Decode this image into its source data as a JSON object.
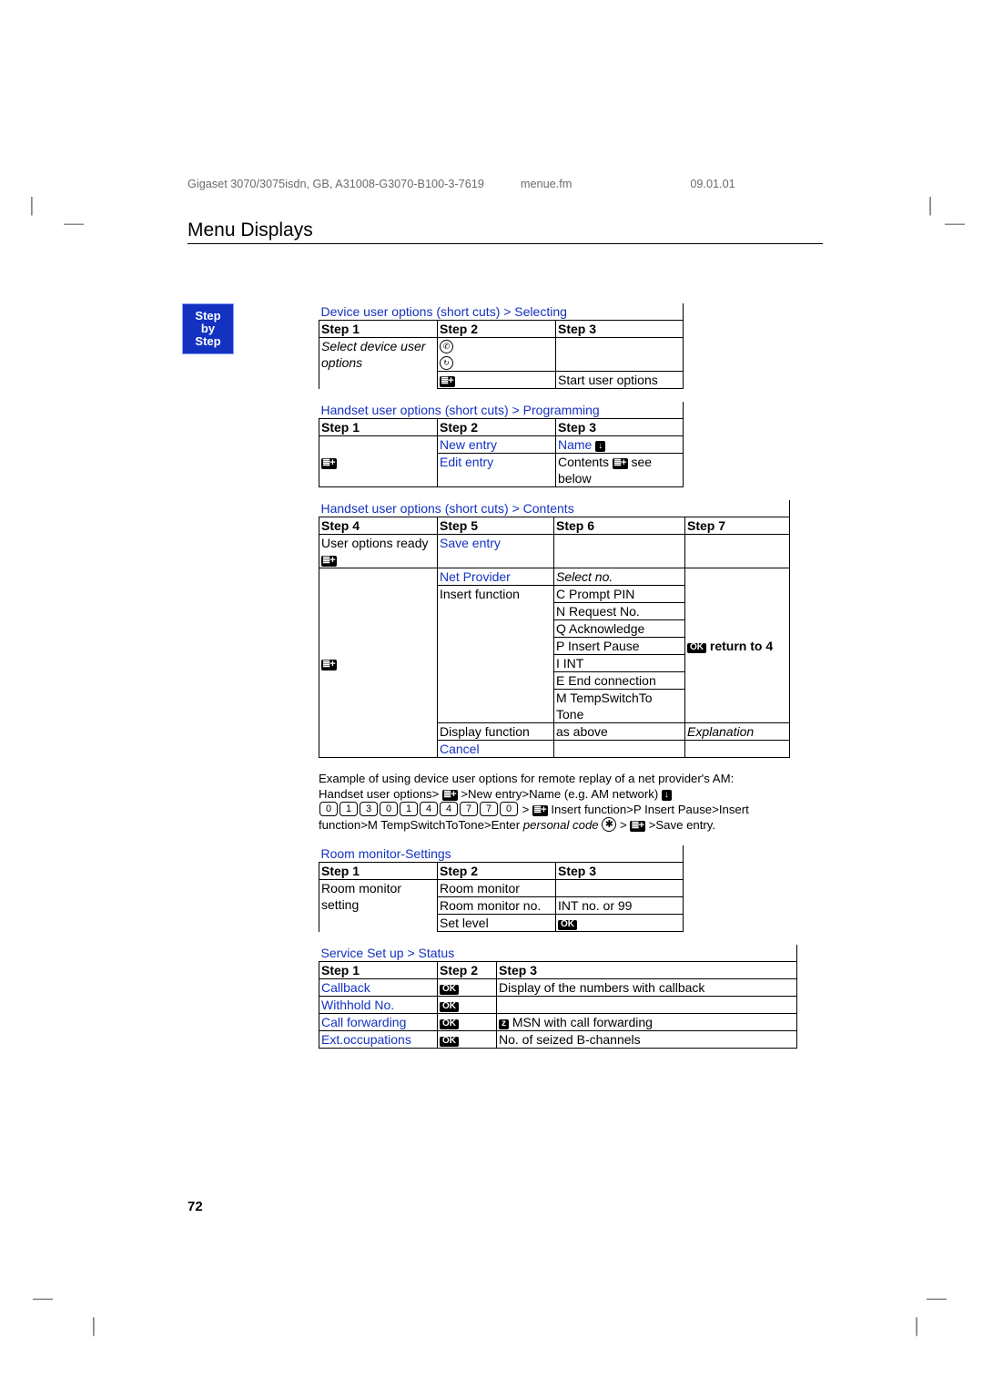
{
  "runhead": {
    "left": "Gigaset 3070/3075isdn, GB, A31008-G3070-B100-3-7619",
    "mid": "menue.fm",
    "right": "09.01.01"
  },
  "section_title": "Menu Displays",
  "steptab": {
    "l1": "Step",
    "l2": "by",
    "l3": "Step"
  },
  "t1": {
    "caption": "Device user options (short cuts) > Selecting",
    "h1": "Step 1",
    "h2": "Step 2",
    "h3": "Step 3",
    "r1c1a": "Select device user",
    "r1c1b": "options",
    "r2c3": "Start user options"
  },
  "t2": {
    "caption": "Handset user options (short cuts) > Programming",
    "h1": "Step 1",
    "h2": "Step 2",
    "h3": "Step 3",
    "r1c2": "New entry",
    "r1c3": "Name",
    "r2c2": "Edit entry",
    "r2c3a": "Contents",
    "r2c3b": " see below"
  },
  "t3": {
    "caption": "Handset user options (short cuts) > Contents",
    "h1": "Step 4",
    "h2": "Step 5",
    "h3": "Step 6",
    "h4": "Step 7",
    "r1c1": "User options ready",
    "r1c2": "Save entry",
    "r2c2": "Net Provider",
    "r2c3": "Select no.",
    "r3c2": "Insert function",
    "r3c3_1": "C Prompt PIN",
    "r3c3_2": "N Request No.",
    "r3c3_3": "Q Acknowledge",
    "r3c3_4": "P Insert Pause",
    "r3c3_5": "I INT",
    "r3c3_6": "E End connection",
    "r3c3_7": "M TempSwitchTo Tone",
    "r3c4": "return to 4",
    "r4c2": "Display function",
    "r4c3": "as above",
    "r4c4": "Explanation",
    "r5c2": "Cancel"
  },
  "example": {
    "l1a": "Example of using device user options for remote replay of a net provider's AM:",
    "l2a": "Handset user options> ",
    "l2b": " >New entry>Name (e.g. AM network) ",
    "digits": [
      "0",
      "1",
      "3",
      "0",
      "1",
      "4",
      "4",
      "7",
      "7",
      "0"
    ],
    "l3b": " Insert function>P Insert Pause>Insert",
    "l4a": "function>M TempSwitchToTone>Enter ",
    "l4b": "personal code",
    "l4c": " > ",
    "l4d": " >Save entry."
  },
  "t4": {
    "caption": "Room monitor-Settings",
    "h1": "Step 1",
    "h2": "Step 2",
    "h3": "Step 3",
    "r1c1": "Room monitor setting",
    "r1c2": "Room monitor",
    "r2c2": "Room monitor no.",
    "r2c3": "INT no. or 99",
    "r3c2": "Set level"
  },
  "t5": {
    "caption_a": "Service Set up > ",
    "caption_b": "Status",
    "h1": "Step 1",
    "h2": "Step 2",
    "h3": "Step 3",
    "r1c1": "Callback",
    "r1c3": "Display of the numbers with callback",
    "r2c1": "Withhold No.",
    "r3c1": "Call forwarding",
    "r3c3": "MSN with call forwarding",
    "r4c1": "Ext.occupations",
    "r4c3": "No. of seized B-channels"
  },
  "page_number": "72"
}
